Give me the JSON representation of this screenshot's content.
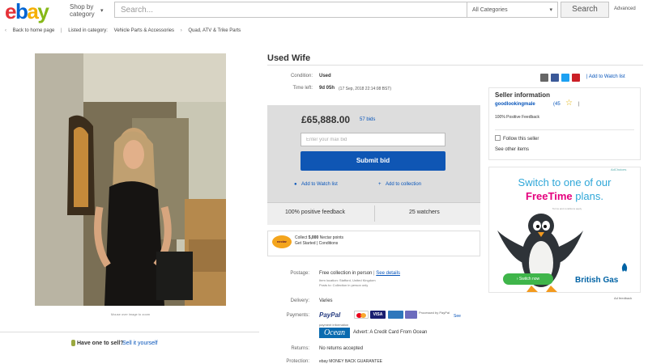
{
  "header": {
    "logo": [
      "e",
      "b",
      "a",
      "y"
    ],
    "shop_by": "Shop by",
    "category": "category",
    "search_placeholder": "Search...",
    "category_select": "All Categories",
    "search_button": "Search",
    "advanced": "Advanced"
  },
  "breadcrumb": {
    "back": "Back to home page",
    "listed_in": "Listed in category:",
    "path": [
      "Vehicle Parts & Accessories",
      "Quad, ATV & Trike Parts"
    ]
  },
  "listing": {
    "title": "Used Wife",
    "photo_caption": "Mouse over image to zoom",
    "condition_label": "Condition:",
    "condition_value": "Used",
    "time_left_label": "Time left:",
    "time_left_value": "9d 05h",
    "time_left_detail": "(17 Sep, 2018   22:14:08 BST)",
    "price": "£65,888.00",
    "bids": "57 bids",
    "bid_placeholder": "Enter your max bid",
    "submit_bid": "Submit bid",
    "add_watch": "Add to Watch list",
    "add_collection": "Add to collection",
    "positive_feedback": "100% positive feedback",
    "watchers": "25 watchers"
  },
  "nectar": {
    "logo": "nectar",
    "line1a": "Collect ",
    "line1b": "5,000",
    "line1c": " Nectar points",
    "line2": "Get Started  |  Conditions"
  },
  "details": {
    "postage_label": "Postage:",
    "postage_value": "Free collection in person",
    "postage_link": "See details",
    "postage_sub1": "Item location:  Stafford, United Kingdom",
    "postage_sub2": "Posts to:  Collection in person only",
    "delivery_label": "Delivery:",
    "delivery_value": "Varies",
    "payments_label": "Payments:",
    "paypal": "PayPal",
    "visa": "VISA",
    "processed": "Processed by PayPal",
    "see_payments": "See",
    "payment_info": "payment information",
    "ocean_logo": "Ocean",
    "ocean_text": "Advert: A Credit Card From Ocean",
    "returns_label": "Returns:",
    "returns_value": "No returns accepted",
    "protection_label": "Protection:",
    "protection_value": "ebay MONEY BACK GUARANTEE"
  },
  "sell": {
    "question": "Have one to sell?",
    "link": "Sell it yourself"
  },
  "seller": {
    "watch_list": "Add to Watch list",
    "heading": "Seller information",
    "name": "goodlookingmale",
    "score": "(45",
    "feedback": "100% Positive Feedback",
    "follow": "Follow this seller",
    "see_other": "See other items"
  },
  "ad": {
    "choices": "AdChoices",
    "line1": "Switch to one of our",
    "line2_brand": "FreeTime",
    "line2_rest": " plans.",
    "small": "Terms and conditions apply",
    "button": "Switch now",
    "logo": "British Gas",
    "feedback": "Ad feedback"
  },
  "colors": {
    "brand_blue": "#0f56b4",
    "link_blue": "#0654ba",
    "ad_cyan": "#2fa7d8",
    "ad_magenta": "#e5007e"
  }
}
